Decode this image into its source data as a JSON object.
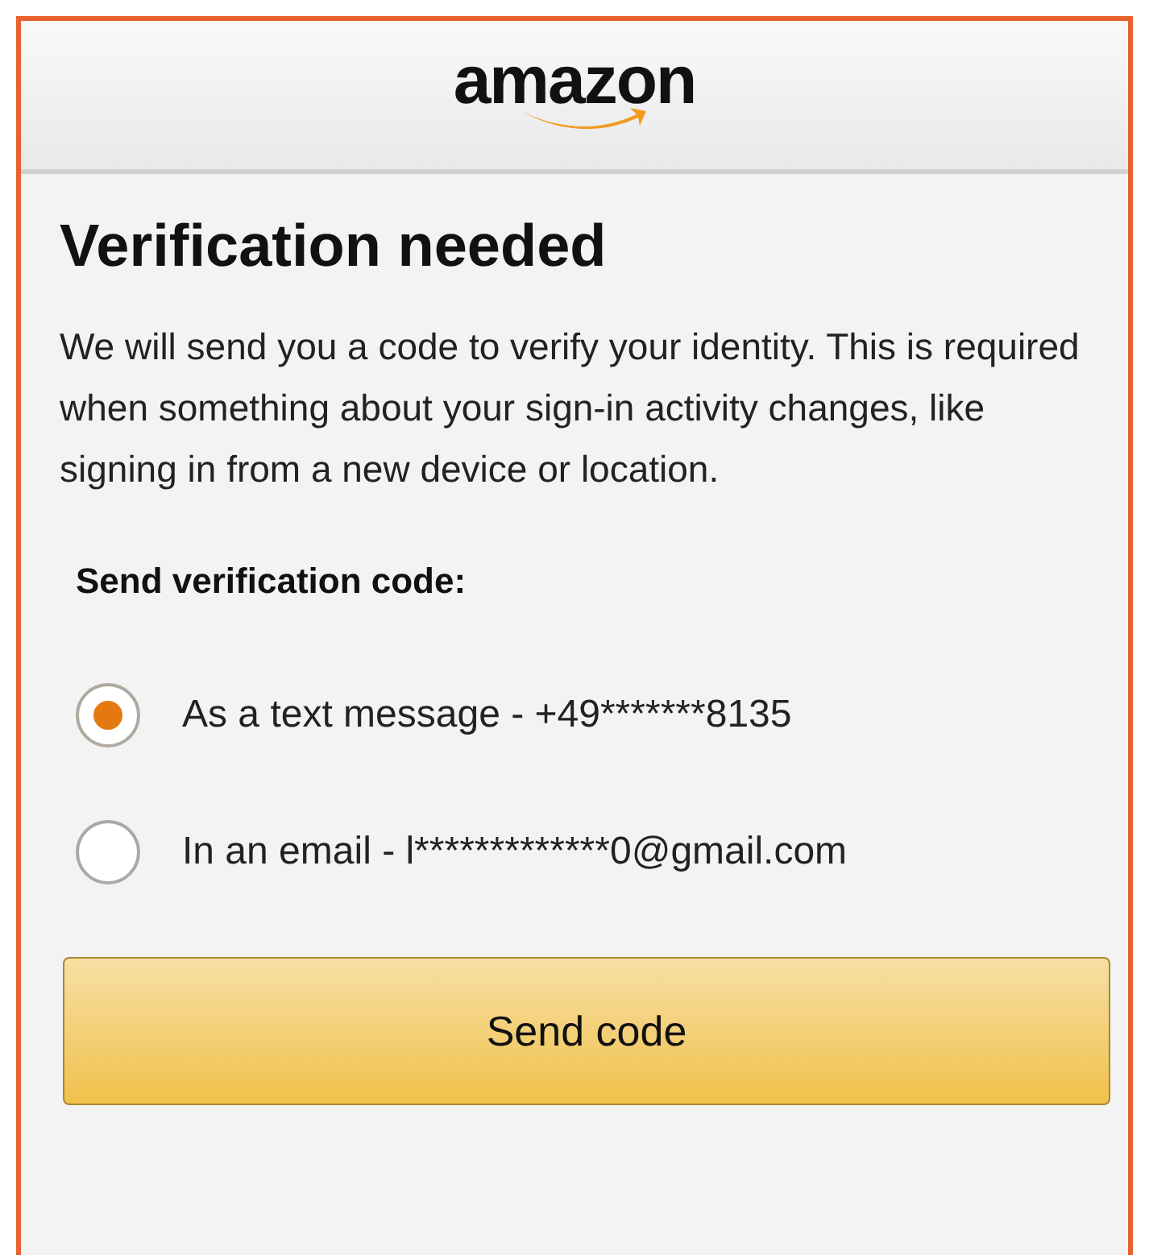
{
  "header": {
    "logo": "amazon"
  },
  "title": "Verification needed",
  "description": "We will send you a code to verify your identity. This is required when something about your sign-in activity changes, like signing in from a new device or location.",
  "options_label": "Send verification code:",
  "options": [
    {
      "label": "As a text message - +49*******8135",
      "selected": true
    },
    {
      "label": "In an email - l*************0@gmail.com",
      "selected": false
    }
  ],
  "button": "Send code"
}
